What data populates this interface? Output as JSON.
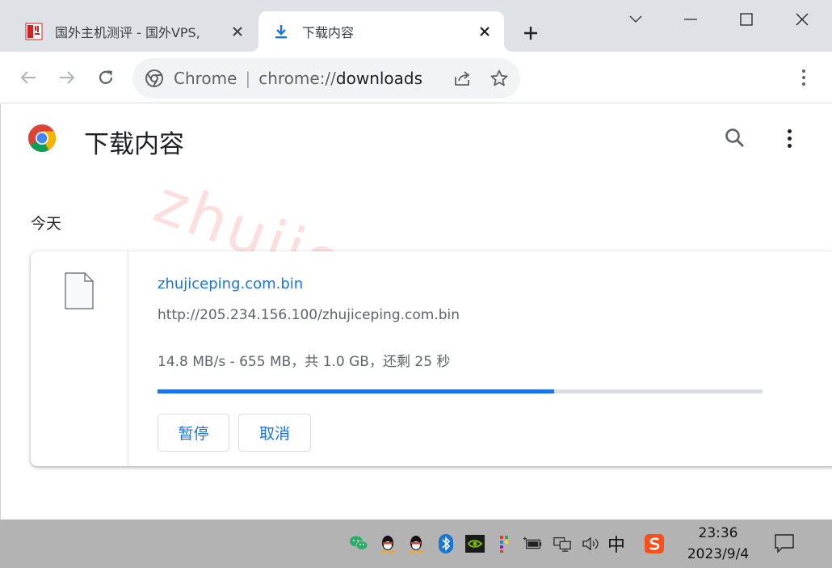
{
  "tabs": [
    {
      "title": "国外主机测评 - 国外VPS,",
      "active": false
    },
    {
      "title": "下载内容",
      "active": true
    }
  ],
  "omnibox": {
    "site_label": "Chrome",
    "separator": "|",
    "url_scheme": "chrome://",
    "url_path": "downloads"
  },
  "page": {
    "title": "下载内容",
    "date_group": "今天",
    "watermark": "zhujiceping.com"
  },
  "download": {
    "file_name": "zhujiceping.com.bin",
    "url": "http://205.234.156.100/zhujiceping.com.bin",
    "status": "14.8 MB/s - 655 MB，共 1.0 GB，还剩 25 秒",
    "progress_fraction": 0.655,
    "pause_label": "暂停",
    "cancel_label": "取消"
  },
  "taskbar": {
    "ime": "中",
    "time": "23:36",
    "date": "2023/9/4"
  },
  "colors": {
    "accent": "#1a73e8",
    "tabstrip": "#dee1e6",
    "taskbar": "#b3b3b3"
  }
}
